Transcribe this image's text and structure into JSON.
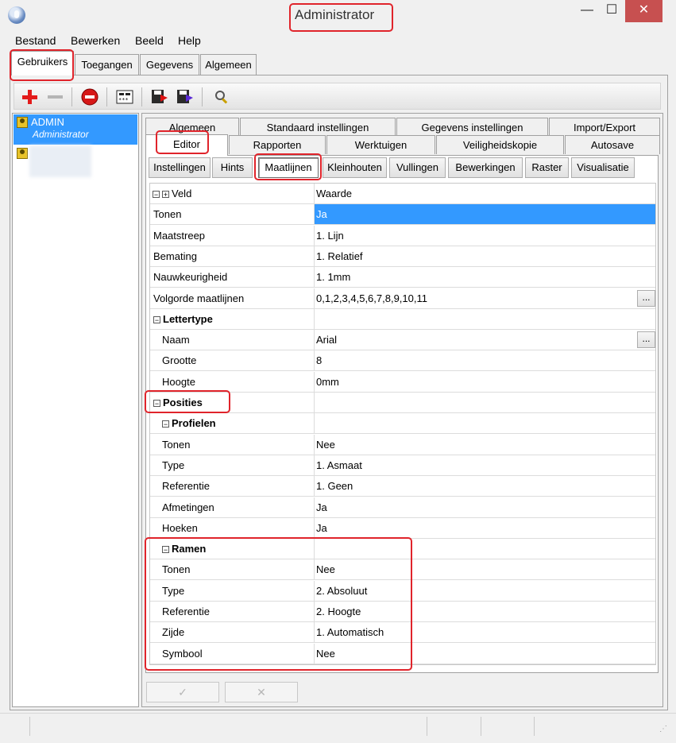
{
  "window": {
    "title": "Administrator",
    "minimize": "—",
    "maximize": "☐",
    "close": "✕"
  },
  "menu": [
    "Bestand",
    "Bewerken",
    "Beeld",
    "Help"
  ],
  "main_tabs": [
    "Gebruikers",
    "Toegangen",
    "Gegevens",
    "Algemeen"
  ],
  "toolbar": {
    "icons": [
      "add-icon",
      "remove-icon",
      "delete-icon",
      "password-icon",
      "import-icon",
      "export-icon",
      "search-icon"
    ]
  },
  "users": [
    {
      "name": "ADMIN",
      "role": "Administrator"
    },
    {
      "name": "",
      "role": ""
    }
  ],
  "settings_tabs_row1": [
    "Algemeen",
    "Standaard instellingen",
    "Gegevens instellingen",
    "Import/Export"
  ],
  "settings_tabs_row2": [
    "Editor",
    "Rapporten",
    "Werktuigen",
    "Veiligheidskopie",
    "Autosave"
  ],
  "sub_buttons": [
    "Instellingen",
    "Hints",
    "Maatlijnen",
    "Kleinhouten",
    "Vullingen",
    "Bewerkingen",
    "Raster",
    "Visualisatie"
  ],
  "grid": {
    "header_field": "Veld",
    "header_value": "Waarde",
    "rows": [
      {
        "field": "Tonen",
        "value": "Ja",
        "selected": true
      },
      {
        "field": "Maatstreep",
        "value": "1. Lijn"
      },
      {
        "field": "Bemating",
        "value": "1. Relatief"
      },
      {
        "field": "Nauwkeurigheid",
        "value": "1. 1mm"
      },
      {
        "field": "Volgorde maatlijnen",
        "value": "0,1,2,3,4,5,6,7,8,9,10,11",
        "ellipsis": "..."
      },
      {
        "field": "Lettertype",
        "value": "",
        "group": true,
        "level": 0
      },
      {
        "field": "Naam",
        "value": "Arial",
        "level": 1,
        "ellipsis": "..."
      },
      {
        "field": "Grootte",
        "value": "8",
        "level": 1
      },
      {
        "field": "Hoogte",
        "value": "0mm",
        "level": 1
      },
      {
        "field": "Posities",
        "value": "",
        "group": true,
        "level": 0
      },
      {
        "field": "Profielen",
        "value": "",
        "group": true,
        "level": 1
      },
      {
        "field": "Tonen",
        "value": "Nee",
        "level": 1
      },
      {
        "field": "Type",
        "value": "1. Asmaat",
        "level": 1
      },
      {
        "field": "Referentie",
        "value": "1. Geen",
        "level": 1
      },
      {
        "field": "Afmetingen",
        "value": "Ja",
        "level": 1
      },
      {
        "field": "Hoeken",
        "value": "Ja",
        "level": 1
      },
      {
        "field": "Ramen",
        "value": "",
        "group": true,
        "level": 1
      },
      {
        "field": "Tonen",
        "value": "Nee",
        "level": 1
      },
      {
        "field": "Type",
        "value": "2. Absoluut",
        "level": 1
      },
      {
        "field": "Referentie",
        "value": "2. Hoogte",
        "level": 1
      },
      {
        "field": "Zijde",
        "value": "1. Automatisch",
        "level": 1
      },
      {
        "field": "Symbool",
        "value": "Nee",
        "level": 1
      }
    ]
  },
  "actions": {
    "apply": "✓",
    "cancel": "✕"
  }
}
